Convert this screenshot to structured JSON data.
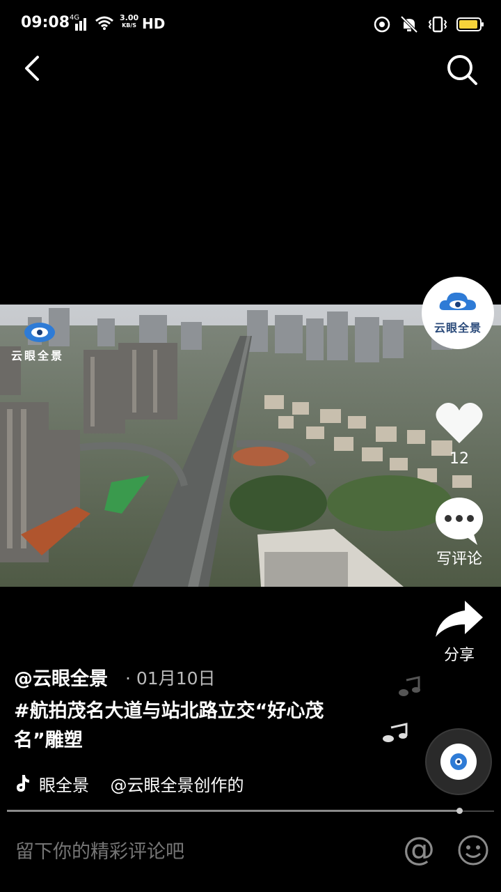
{
  "status_bar": {
    "time": "09:08",
    "network": "4G",
    "speed_value": "3.00",
    "speed_unit": "KB/S",
    "hd": "HD"
  },
  "icons": {
    "back": "back-arrow-icon",
    "search": "search-icon",
    "like": "heart-icon",
    "comment": "comment-bubble-icon",
    "share": "share-arrow-icon",
    "music": "tiktok-note-icon",
    "at": "at-icon",
    "emoji": "emoji-icon"
  },
  "video": {
    "watermark": "云眼全景"
  },
  "actions": {
    "avatar_label": "云眼全景",
    "like_count": "12",
    "comment_label": "写评论",
    "share_label": "分享"
  },
  "post": {
    "author": "@云眼全景",
    "date": "· 01月10日",
    "caption": "#航拍茂名大道与站北路立交“好心茂名”雕塑",
    "music_text": "眼全景    @云眼全景创作的",
    "playback_progress": 0.93
  },
  "comment_bar": {
    "placeholder": "留下你的精彩评论吧"
  },
  "colors": {
    "background": "#000000",
    "battery": "#f5d33a",
    "logo_blue": "#2e7bd6"
  }
}
